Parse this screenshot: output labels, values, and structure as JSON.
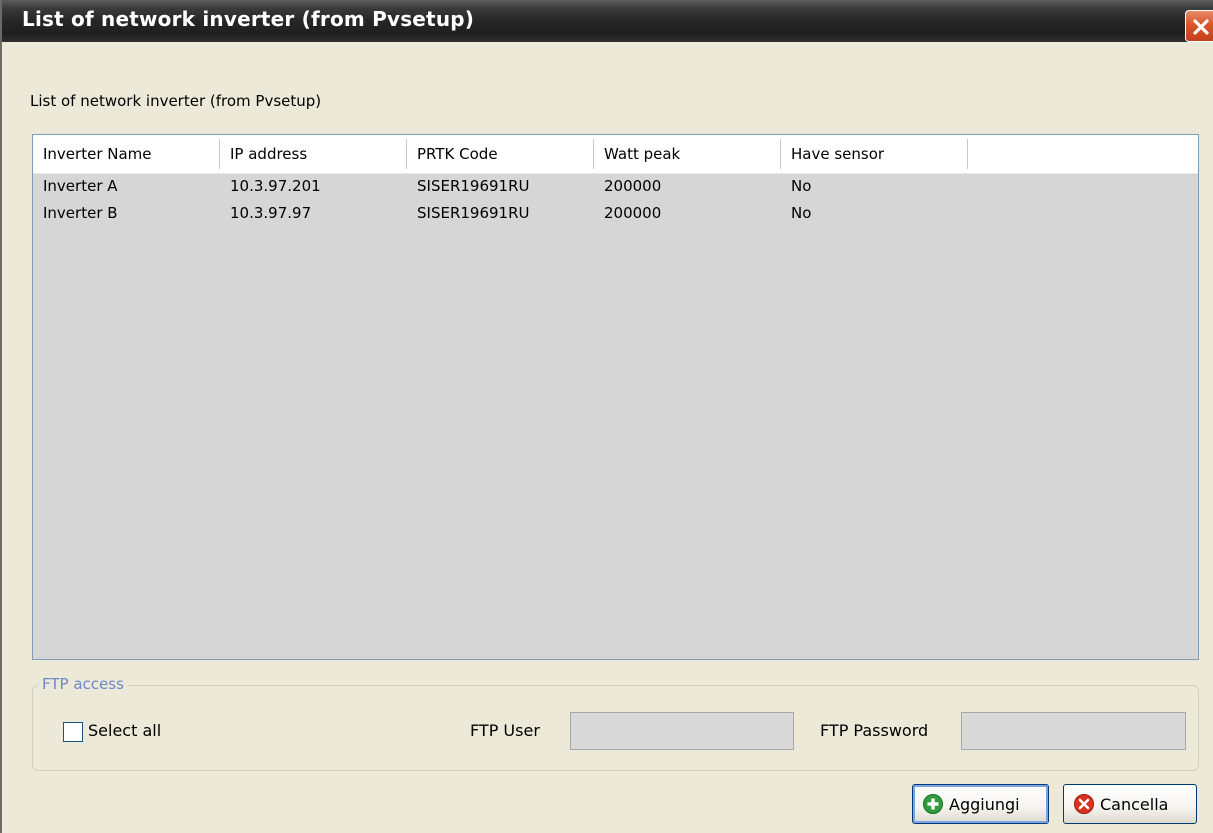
{
  "window": {
    "title": "List of network inverter (from Pvsetup)"
  },
  "section_label": "List of network inverter (from Pvsetup)",
  "table": {
    "columns": [
      "Inverter Name",
      "IP address",
      "PRTK Code",
      "Watt peak",
      "Have sensor"
    ],
    "rows": [
      [
        "Inverter A",
        "10.3.97.201",
        "SISER19691RU",
        "200000",
        "No"
      ],
      [
        "Inverter B",
        "10.3.97.97",
        "SISER19691RU",
        "200000",
        "No"
      ]
    ]
  },
  "ftp": {
    "legend": "FTP access",
    "select_all_label": "Select all",
    "select_all_checked": false,
    "user_label": "FTP User",
    "user_value": "",
    "password_label": "FTP Password",
    "password_value": ""
  },
  "buttons": {
    "add_label": "Aggiungi",
    "cancel_label": "Cancella"
  },
  "icons": {
    "close": "close-icon",
    "add": "plus-circle-icon",
    "cancel": "x-circle-icon"
  },
  "colors": {
    "titlebar": "#262626",
    "close_button": "#d9552d",
    "dialog_background": "#ece9d8",
    "list_background": "#d6d6d6",
    "add_icon": "#2f9e3a",
    "cancel_icon": "#d9331f",
    "legend_text": "#6f86c7"
  }
}
